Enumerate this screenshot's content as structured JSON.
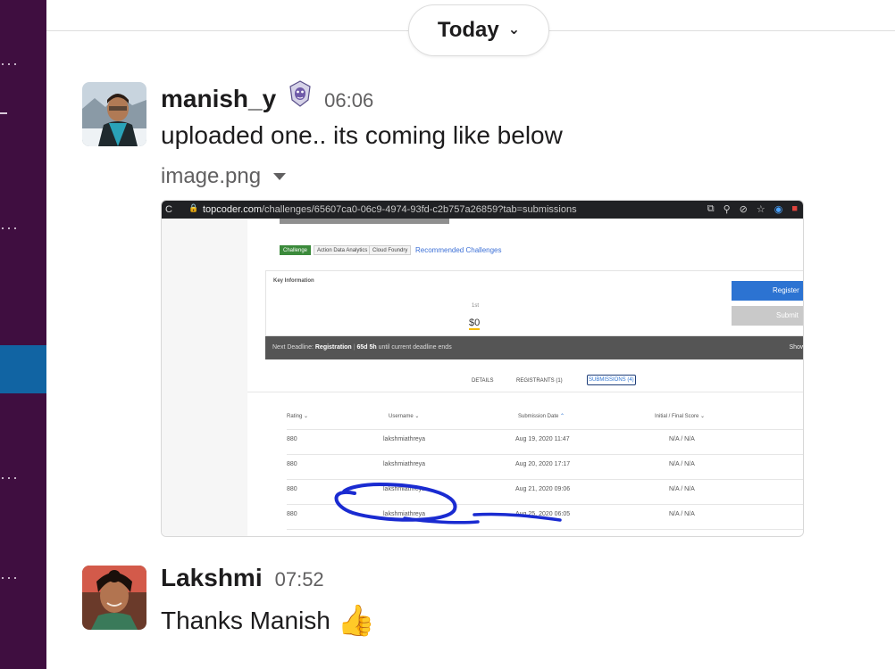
{
  "divider": {
    "label": "Today"
  },
  "messages": [
    {
      "author": "manish_y",
      "time": "06:06",
      "text": "uploaded one.. its coming like below",
      "file": {
        "name": "image.png",
        "screenshot": {
          "url_host": "topcoder.com",
          "url_path": "/challenges/65607ca0-06c9-4974-93fd-c2b757a26859?tab=submissions",
          "tags": [
            "Challenge",
            "Action Data Analytics",
            "Cloud Foundry"
          ],
          "recommended": "Recommended Challenges",
          "key_info_label": "Key Information",
          "prize_place": "1st",
          "prize_value": "$0",
          "register_button": "Register",
          "submit_button": "Submit",
          "deadline": {
            "prefix": "Next Deadline:",
            "phase": "Registration",
            "remaining": "65d 5h",
            "suffix": "until current deadline ends",
            "show": "Show"
          },
          "tabs": [
            "DETAILS",
            "REGISTRANTS (1)",
            "SUBMISSIONS (4)"
          ],
          "columns": [
            "Rating",
            "Username",
            "Submission Date",
            "Initial / Final Score"
          ],
          "rows": [
            {
              "rating": "880",
              "username": "lakshmiathreya",
              "date": "Aug 19, 2020 11:47",
              "score": "N/A / N/A"
            },
            {
              "rating": "880",
              "username": "lakshmiathreya",
              "date": "Aug 20, 2020 17:17",
              "score": "N/A / N/A"
            },
            {
              "rating": "880",
              "username": "lakshmiathreya",
              "date": "Aug 21, 2020 09:06",
              "score": "N/A / N/A"
            },
            {
              "rating": "880",
              "username": "lakshmiathreya",
              "date": "Aug 25, 2020 06:05",
              "score": "N/A / N/A"
            }
          ]
        }
      }
    },
    {
      "author": "Lakshmi",
      "time": "07:52",
      "text": "Thanks Manish",
      "emoji": "👍"
    }
  ],
  "colors": {
    "sidebar": "#3f0e40",
    "sidebar_active": "#1164a3",
    "link_blue": "#2c73d2",
    "annotation_pen": "#1a2bd1"
  }
}
